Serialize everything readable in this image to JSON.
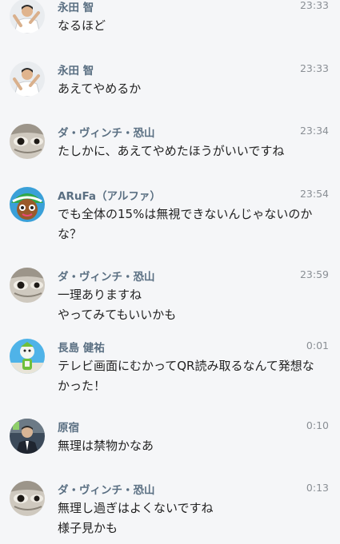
{
  "messages": [
    {
      "name": "永田 智",
      "time": "23:33",
      "lines": [
        "なるほど"
      ],
      "avatar": "person-pose-avatar"
    },
    {
      "name": "永田 智",
      "time": "23:33",
      "lines": [
        "あえてやめるか"
      ],
      "avatar": "person-pose-avatar"
    },
    {
      "name": "ダ・ヴィンチ・恐山",
      "time": "23:34",
      "lines": [
        "たしかに、あえてやめたほうがいいですね"
      ],
      "avatar": "eye-closeup-avatar"
    },
    {
      "name": "ARuFa（アルファ）",
      "time": "23:54",
      "lines": [
        "でも全体の15%は無視できないんじゃないのか",
        "な？"
      ],
      "avatar": "cartoon-face-avatar"
    },
    {
      "name": "ダ・ヴィンチ・恐山",
      "time": "23:59",
      "lines": [
        "一理ありますね",
        "やってみてもいいかも"
      ],
      "avatar": "eye-closeup-avatar"
    },
    {
      "name": "長島 健祐",
      "time": "0:01",
      "lines": [
        "テレビ画面にむかってQR読み取るなんて発想な",
        "かった！"
      ],
      "avatar": "mascot-avatar"
    },
    {
      "name": "原宿",
      "time": "0:10",
      "lines": [
        "無理は禁物かなあ"
      ],
      "avatar": "suit-man-avatar"
    },
    {
      "name": "ダ・ヴィンチ・恐山",
      "time": "0:13",
      "lines": [
        "無理し過ぎはよくないですね",
        "様子見かも"
      ],
      "avatar": "eye-closeup-avatar"
    }
  ],
  "colors": {
    "background": "#f5f6f8",
    "name": "#5a6f82",
    "time": "#8a8f95",
    "text": "#222222"
  }
}
